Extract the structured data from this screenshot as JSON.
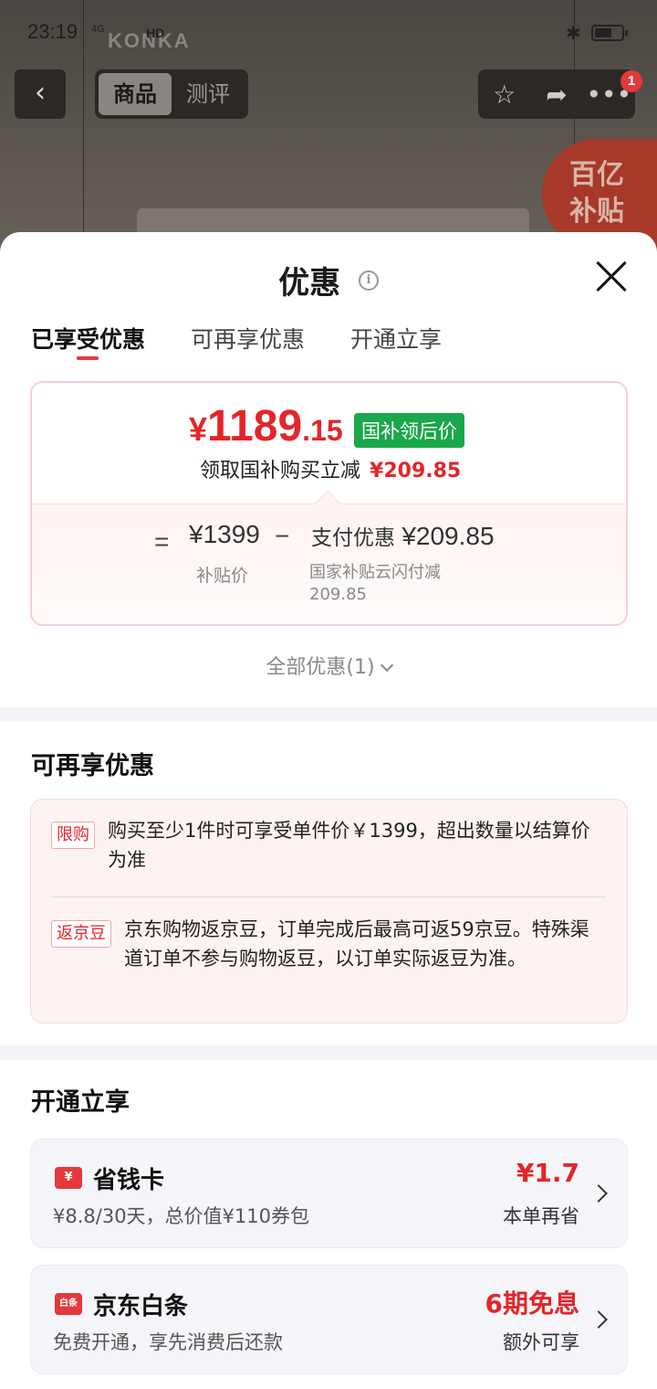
{
  "statusbar": {
    "time": "23:19",
    "signal": "4G",
    "hd": "HD",
    "watermark": "KONKA"
  },
  "nav": {
    "back_icon": "chevron-left-icon",
    "tabs": [
      {
        "label": "商品",
        "active": true
      },
      {
        "label": "测评",
        "active": false
      }
    ],
    "actions": [
      "star-icon",
      "share-icon",
      "more-icon"
    ],
    "badge_count": "1",
    "subsidy_badge": {
      "line1": "百亿",
      "line2": "补贴"
    }
  },
  "sheet": {
    "title": "优惠",
    "tabs": [
      {
        "label": "已享受优惠",
        "active": true
      },
      {
        "label": "可再享优惠",
        "active": false
      },
      {
        "label": "开通立享",
        "active": false
      }
    ],
    "price_card": {
      "currency": "¥",
      "price_int": "1189",
      "price_dec": ".15",
      "tag": "国补领后价",
      "claim_text": "领取国补购买立减",
      "claim_amount": "¥209.85",
      "equals": "=",
      "base_price": "¥1399",
      "base_label": "补贴价",
      "minus": "−",
      "pay_label": "支付优惠",
      "pay_amount": "¥209.85",
      "pay_sub": "国家补贴云闪付减209.85"
    },
    "all_discounts": "全部优惠(1)",
    "more_section": {
      "title": "可再享优惠",
      "items": [
        {
          "tag": "限购",
          "text": "购买至少1件时可享受单件价￥1399，超出数量以结算价为准"
        },
        {
          "tag": "返京豆",
          "text": "京东购物返京豆，订单完成后最高可返59京豆。特殊渠道订单不参与购物返豆，以订单实际返豆为准。"
        }
      ]
    },
    "open_section": {
      "title": "开通立享",
      "items": [
        {
          "icon": "yuan-card-icon",
          "icon_text": "¥",
          "name": "省钱卡",
          "desc": "¥8.8/30天，总价值¥110券包",
          "value": "¥1.7",
          "value_sub": "本单再省"
        },
        {
          "icon": "baitiao-icon",
          "icon_text": "白条",
          "name": "京东白条",
          "desc": "免费开通，享先消费后还款",
          "value": "6期免息",
          "value_sub": "额外可享"
        }
      ]
    }
  }
}
